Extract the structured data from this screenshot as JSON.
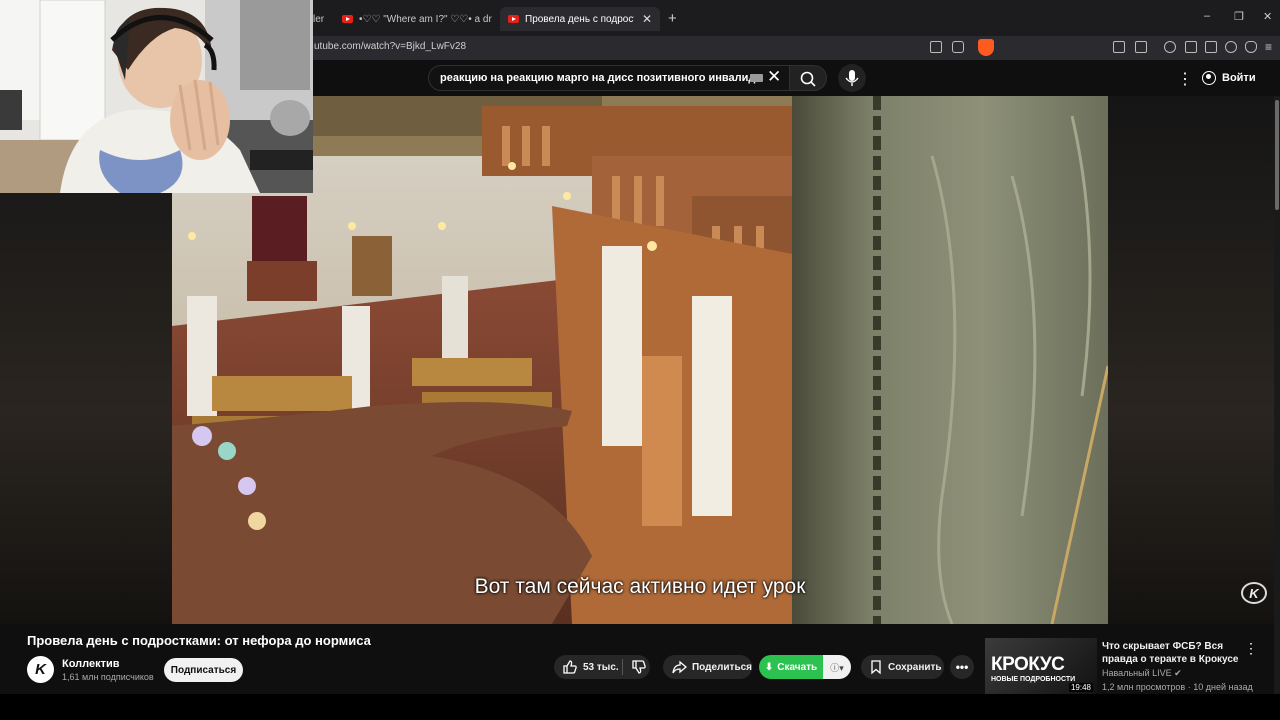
{
  "browser": {
    "tabs": [
      {
        "label": "ler"
      },
      {
        "label": "•♡♡ \"Where am I?\" ♡♡• a dreamco"
      },
      {
        "label": "Провела день с подростками: о"
      }
    ],
    "new_tab": "+",
    "tab_close": "✕",
    "url": "utube.com/watch?v=Bjkd_LwFv28",
    "window_controls": [
      "–",
      "❐",
      "✕"
    ]
  },
  "header": {
    "search_value": "реакцию на реакцию марго на дисс позитивного инвалида",
    "clear": "✕",
    "more": "⋮",
    "signin_label": "Войти"
  },
  "player": {
    "subtitle": "Вот там сейчас активно идет урок",
    "watermark": "K"
  },
  "video": {
    "title": "Провела день с подростками: от нефора до нормиса",
    "channel_initial": "K",
    "channel_name": "Коллектив",
    "subscribers": "1,61 млн подписчиков",
    "subscribe_label": "Подписаться",
    "likes": "53 тыс.",
    "share_label": "Поделиться",
    "download_label": "Скачать",
    "save_label": "Сохранить",
    "more": "•••"
  },
  "recommended": {
    "thumb_big": "КРОКУС",
    "thumb_small": "НОВЫЕ ПОДРОБНОСТИ",
    "duration": "19:48",
    "title": "Что скрывает ФСБ? Вся правда о теракте в Крокусе",
    "channel": "Навальный LIVE ✔",
    "meta": "1,2 млн просмотров · 10 дней назад",
    "more": "⋮"
  },
  "icons": [
    "youtube-favicon-icon",
    "search-icon",
    "mic-icon",
    "keyboard-icon",
    "user-icon",
    "like-icon",
    "dislike-icon",
    "share-icon",
    "download-icon",
    "save-icon",
    "info-icon",
    "brave-icon",
    "extensions-icon"
  ],
  "colors": {
    "page_bg": "#0f0f0f",
    "download_green": "#2bc24f",
    "yt_red": "#e62117"
  }
}
